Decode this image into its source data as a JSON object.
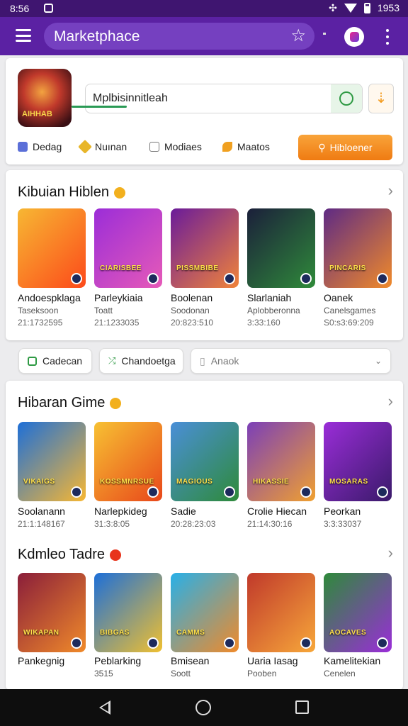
{
  "status": {
    "time": "8:56",
    "clock": "1953"
  },
  "appbar": {
    "title": "Marketphace"
  },
  "hero": {
    "search_value": "Mplbisinnitleah",
    "tabs": [
      {
        "label": "Dedag",
        "color": "#5b6fd8"
      },
      {
        "label": "Nuınan",
        "color": "#e8b62a"
      },
      {
        "label": "Modiaes",
        "color": "#888888"
      },
      {
        "label": "Maatos",
        "color": "#f0a020"
      }
    ],
    "action_label": "Hibloener"
  },
  "section1": {
    "title": "Kibuian Hiblen",
    "items": [
      {
        "name": "Andoespklaga",
        "sub": "Taseksoon",
        "num": "21:1732595",
        "caption": "",
        "bg": "linear-gradient(135deg,#f7b733,#fc4a1a)"
      },
      {
        "name": "Parleykiaia",
        "sub": "Toatt",
        "num": "21:1233035",
        "caption": "CIARISBEE",
        "bg": "linear-gradient(135deg,#9b2dd8,#e65ab8)"
      },
      {
        "name": "Boolenan",
        "sub": "Soodonan",
        "num": "20:823:510",
        "caption": "PISSMBIBE",
        "bg": "linear-gradient(135deg,#6a1b9a,#f0833a)"
      },
      {
        "name": "Slarlaniah",
        "sub": "Aplobberonna",
        "num": "3:33:160",
        "caption": "",
        "bg": "linear-gradient(135deg,#1b1f3a,#2f8a3a)"
      },
      {
        "name": "Oanek",
        "sub": "Canelsgames",
        "num": "S0:s3:69:209",
        "caption": "PINCARIS",
        "bg": "linear-gradient(135deg,#5e2a84,#f08a2a)"
      }
    ]
  },
  "filters": {
    "chip1": "Cadecan",
    "chip2": "Chandoetga",
    "select_placeholder": "Anaok"
  },
  "section2": {
    "title": "Hibaran Gime",
    "items": [
      {
        "name": "Soolanann",
        "sub": "",
        "num": "21:1:148167",
        "caption": "VIKAIGS",
        "bg": "linear-gradient(135deg,#1d6fd8,#f7b733)"
      },
      {
        "name": "Narlepkideg",
        "sub": "",
        "num": "31:3:8:05",
        "caption": "KOSSMNRSUE",
        "bg": "linear-gradient(135deg,#f7c133,#e8471a)"
      },
      {
        "name": "Sadie",
        "sub": "",
        "num": "20:28:23:03",
        "caption": "MAGIOUS",
        "bg": "linear-gradient(135deg,#4a8fd8,#2e8a3a)"
      },
      {
        "name": "Crolie Hiecan",
        "sub": "",
        "num": "21:14:30:16",
        "caption": "HIKASSIE",
        "bg": "linear-gradient(135deg,#7b3fb8,#f0a030)"
      },
      {
        "name": "Peorkan",
        "sub": "",
        "num": "3:3:33037",
        "caption": "MOSARAS",
        "bg": "linear-gradient(135deg,#9a2dd8,#3a1a6a)"
      }
    ]
  },
  "section3": {
    "title": "Kdmleo Tadre",
    "items": [
      {
        "name": "Pankegnig",
        "sub": "",
        "num": "",
        "caption": "WIKAPAN",
        "bg": "linear-gradient(135deg,#8a1e3a,#f08a2a)"
      },
      {
        "name": "Peblarking",
        "sub": "3515",
        "num": "",
        "caption": "BIBGAS",
        "bg": "linear-gradient(135deg,#1d6fd8,#f0c030)"
      },
      {
        "name": "Bmisean",
        "sub": "Soott",
        "num": "",
        "caption": "CAMMS",
        "bg": "linear-gradient(135deg,#28b0e8,#f08a2a)"
      },
      {
        "name": "Uaria Iasag",
        "sub": "Pooben",
        "num": "",
        "caption": "",
        "bg": "linear-gradient(135deg,#c0392b,#f7a73a)"
      },
      {
        "name": "Kamelitekian",
        "sub": "Cenelen",
        "num": "",
        "caption": "AOCAVES",
        "bg": "linear-gradient(135deg,#2e8a3a,#9a2dd8)"
      }
    ]
  }
}
